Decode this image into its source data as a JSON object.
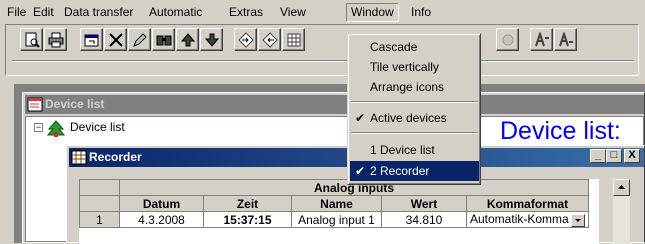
{
  "menubar": {
    "items": [
      "File",
      "Edit",
      "Data transfer",
      "Automatic",
      "Extras",
      "View",
      "Window",
      "Info"
    ]
  },
  "toolbar": {
    "buttons": [
      "print-preview-icon",
      "print-icon",
      "properties-icon",
      "delete-icon",
      "edit-icon",
      "find-icon",
      "arrow-up-icon",
      "arrow-down-icon",
      "import-icon",
      "export-icon",
      "grid-icon",
      "disabled-icon",
      "signal-icon",
      "signal-alt-icon"
    ]
  },
  "window_menu": {
    "items": [
      {
        "label": "Cascade",
        "checked": false
      },
      {
        "label": "Tile vertically",
        "checked": false
      },
      {
        "label": "Arrange icons",
        "checked": false
      },
      {
        "label": "Active devices",
        "checked": true
      },
      {
        "label": "1 Device list",
        "checked": false
      },
      {
        "label": "2 Recorder",
        "checked": true
      }
    ],
    "check_glyph": "✔"
  },
  "device_list_window": {
    "title": "Device list",
    "tree_label": "Device list",
    "tree_expander": "−",
    "big_title": "Device list:"
  },
  "recorder_window": {
    "title": "Recorder",
    "caption_buttons": {
      "minimize": "_",
      "maximize": "□",
      "close": "X"
    }
  },
  "grid": {
    "group_header": "Analog inputs",
    "columns": [
      "Datum",
      "Zeit",
      "Name",
      "Wert",
      "Kommaformat"
    ],
    "rows": [
      {
        "index": "1",
        "datum": "4.3.2008",
        "zeit": "15:37:15",
        "name": "Analog input 1",
        "wert": "34.810",
        "kommaformat": "Automatik-Komma"
      }
    ]
  },
  "colors": {
    "face": "#d4d0c8",
    "active_title": "#0a246a",
    "inactive_title": "#808080",
    "highlight": "#0a246a",
    "big_title_blue": "#0000ff"
  }
}
